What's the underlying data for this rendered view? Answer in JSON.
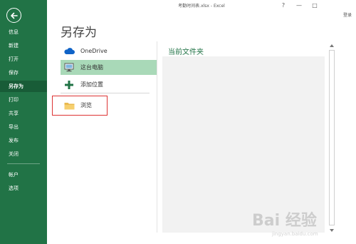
{
  "titlebar": {
    "title": "考勤时间表.xlsx - Excel",
    "help": "?",
    "minimize": "—",
    "maximize": "□",
    "signin": "登录"
  },
  "sidebar": {
    "items": [
      {
        "label": "信息"
      },
      {
        "label": "新建"
      },
      {
        "label": "打开"
      },
      {
        "label": "保存"
      },
      {
        "label": "另存为",
        "active": true
      },
      {
        "label": "打印"
      },
      {
        "label": "共享"
      },
      {
        "label": "导出"
      },
      {
        "label": "发布"
      },
      {
        "label": "关闭"
      }
    ],
    "bottom": [
      {
        "label": "帐户"
      },
      {
        "label": "选项"
      }
    ],
    "color": "#217346",
    "active_color": "#185c37"
  },
  "page": {
    "title": "另存为"
  },
  "places": [
    {
      "label": "OneDrive",
      "icon": "cloud-icon"
    },
    {
      "label": "这台电脑",
      "icon": "computer-icon",
      "selected": true
    },
    {
      "label": "添加位置",
      "icon": "plus-icon"
    },
    {
      "label": "浏览",
      "icon": "folder-icon",
      "highlighted": true
    }
  ],
  "current_folder": {
    "heading": "当前文件夹"
  },
  "colors": {
    "accent": "#217346",
    "selected_place": "#a9d9b8",
    "highlight_box": "#dd3333"
  },
  "watermark": {
    "text": "Bai 经验",
    "caption": "jingyan.baidu.com"
  }
}
